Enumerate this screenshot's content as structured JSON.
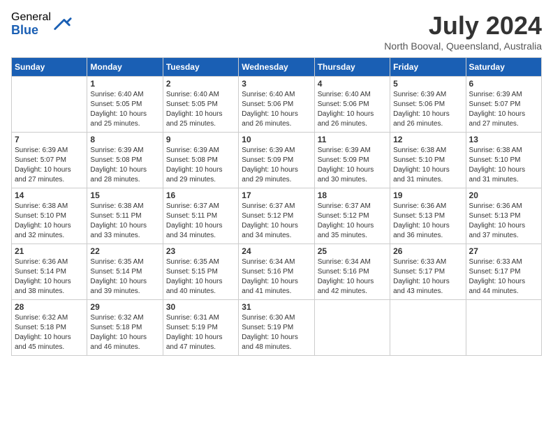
{
  "header": {
    "logo_general": "General",
    "logo_blue": "Blue",
    "month_title": "July 2024",
    "location": "North Booval, Queensland, Australia"
  },
  "days_of_week": [
    "Sunday",
    "Monday",
    "Tuesday",
    "Wednesday",
    "Thursday",
    "Friday",
    "Saturday"
  ],
  "weeks": [
    [
      {
        "day": "",
        "info": ""
      },
      {
        "day": "1",
        "info": "Sunrise: 6:40 AM\nSunset: 5:05 PM\nDaylight: 10 hours\nand 25 minutes."
      },
      {
        "day": "2",
        "info": "Sunrise: 6:40 AM\nSunset: 5:05 PM\nDaylight: 10 hours\nand 25 minutes."
      },
      {
        "day": "3",
        "info": "Sunrise: 6:40 AM\nSunset: 5:06 PM\nDaylight: 10 hours\nand 26 minutes."
      },
      {
        "day": "4",
        "info": "Sunrise: 6:40 AM\nSunset: 5:06 PM\nDaylight: 10 hours\nand 26 minutes."
      },
      {
        "day": "5",
        "info": "Sunrise: 6:39 AM\nSunset: 5:06 PM\nDaylight: 10 hours\nand 26 minutes."
      },
      {
        "day": "6",
        "info": "Sunrise: 6:39 AM\nSunset: 5:07 PM\nDaylight: 10 hours\nand 27 minutes."
      }
    ],
    [
      {
        "day": "7",
        "info": "Sunrise: 6:39 AM\nSunset: 5:07 PM\nDaylight: 10 hours\nand 27 minutes."
      },
      {
        "day": "8",
        "info": "Sunrise: 6:39 AM\nSunset: 5:08 PM\nDaylight: 10 hours\nand 28 minutes."
      },
      {
        "day": "9",
        "info": "Sunrise: 6:39 AM\nSunset: 5:08 PM\nDaylight: 10 hours\nand 29 minutes."
      },
      {
        "day": "10",
        "info": "Sunrise: 6:39 AM\nSunset: 5:09 PM\nDaylight: 10 hours\nand 29 minutes."
      },
      {
        "day": "11",
        "info": "Sunrise: 6:39 AM\nSunset: 5:09 PM\nDaylight: 10 hours\nand 30 minutes."
      },
      {
        "day": "12",
        "info": "Sunrise: 6:38 AM\nSunset: 5:10 PM\nDaylight: 10 hours\nand 31 minutes."
      },
      {
        "day": "13",
        "info": "Sunrise: 6:38 AM\nSunset: 5:10 PM\nDaylight: 10 hours\nand 31 minutes."
      }
    ],
    [
      {
        "day": "14",
        "info": "Sunrise: 6:38 AM\nSunset: 5:10 PM\nDaylight: 10 hours\nand 32 minutes."
      },
      {
        "day": "15",
        "info": "Sunrise: 6:38 AM\nSunset: 5:11 PM\nDaylight: 10 hours\nand 33 minutes."
      },
      {
        "day": "16",
        "info": "Sunrise: 6:37 AM\nSunset: 5:11 PM\nDaylight: 10 hours\nand 34 minutes."
      },
      {
        "day": "17",
        "info": "Sunrise: 6:37 AM\nSunset: 5:12 PM\nDaylight: 10 hours\nand 34 minutes."
      },
      {
        "day": "18",
        "info": "Sunrise: 6:37 AM\nSunset: 5:12 PM\nDaylight: 10 hours\nand 35 minutes."
      },
      {
        "day": "19",
        "info": "Sunrise: 6:36 AM\nSunset: 5:13 PM\nDaylight: 10 hours\nand 36 minutes."
      },
      {
        "day": "20",
        "info": "Sunrise: 6:36 AM\nSunset: 5:13 PM\nDaylight: 10 hours\nand 37 minutes."
      }
    ],
    [
      {
        "day": "21",
        "info": "Sunrise: 6:36 AM\nSunset: 5:14 PM\nDaylight: 10 hours\nand 38 minutes."
      },
      {
        "day": "22",
        "info": "Sunrise: 6:35 AM\nSunset: 5:14 PM\nDaylight: 10 hours\nand 39 minutes."
      },
      {
        "day": "23",
        "info": "Sunrise: 6:35 AM\nSunset: 5:15 PM\nDaylight: 10 hours\nand 40 minutes."
      },
      {
        "day": "24",
        "info": "Sunrise: 6:34 AM\nSunset: 5:16 PM\nDaylight: 10 hours\nand 41 minutes."
      },
      {
        "day": "25",
        "info": "Sunrise: 6:34 AM\nSunset: 5:16 PM\nDaylight: 10 hours\nand 42 minutes."
      },
      {
        "day": "26",
        "info": "Sunrise: 6:33 AM\nSunset: 5:17 PM\nDaylight: 10 hours\nand 43 minutes."
      },
      {
        "day": "27",
        "info": "Sunrise: 6:33 AM\nSunset: 5:17 PM\nDaylight: 10 hours\nand 44 minutes."
      }
    ],
    [
      {
        "day": "28",
        "info": "Sunrise: 6:32 AM\nSunset: 5:18 PM\nDaylight: 10 hours\nand 45 minutes."
      },
      {
        "day": "29",
        "info": "Sunrise: 6:32 AM\nSunset: 5:18 PM\nDaylight: 10 hours\nand 46 minutes."
      },
      {
        "day": "30",
        "info": "Sunrise: 6:31 AM\nSunset: 5:19 PM\nDaylight: 10 hours\nand 47 minutes."
      },
      {
        "day": "31",
        "info": "Sunrise: 6:30 AM\nSunset: 5:19 PM\nDaylight: 10 hours\nand 48 minutes."
      },
      {
        "day": "",
        "info": ""
      },
      {
        "day": "",
        "info": ""
      },
      {
        "day": "",
        "info": ""
      }
    ]
  ]
}
